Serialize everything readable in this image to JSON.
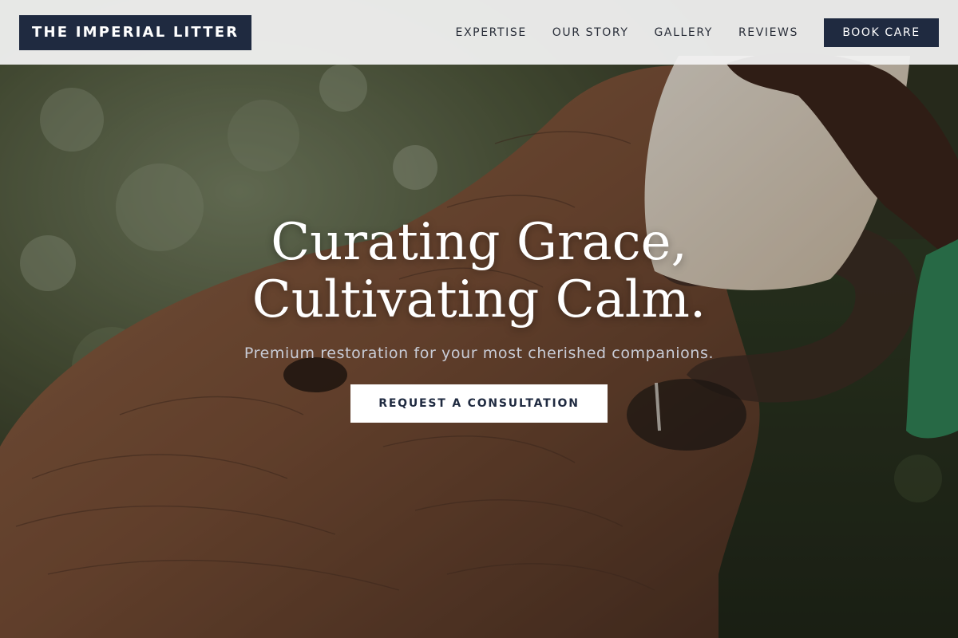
{
  "header": {
    "logo": "THE IMPERIAL LITTER",
    "nav": [
      {
        "label": "EXPERTISE"
      },
      {
        "label": "OUR STORY"
      },
      {
        "label": "GALLERY"
      },
      {
        "label": "REVIEWS"
      }
    ],
    "cta_label": "BOOK CARE"
  },
  "hero": {
    "headline_line1": "Curating Grace,",
    "headline_line2": "Cultivating Calm.",
    "subheadline": "Premium restoration for your most cherished companions.",
    "cta_label": "REQUEST A CONSULTATION",
    "background_image": "baby elephant drinking milk from a bottle held by a caretaker"
  },
  "colors": {
    "brand_navy": "#1f2a40",
    "header_bg": "#f2f2f2",
    "cta_bg": "#ffffff",
    "subheadline_text": "#c9ccd6"
  }
}
